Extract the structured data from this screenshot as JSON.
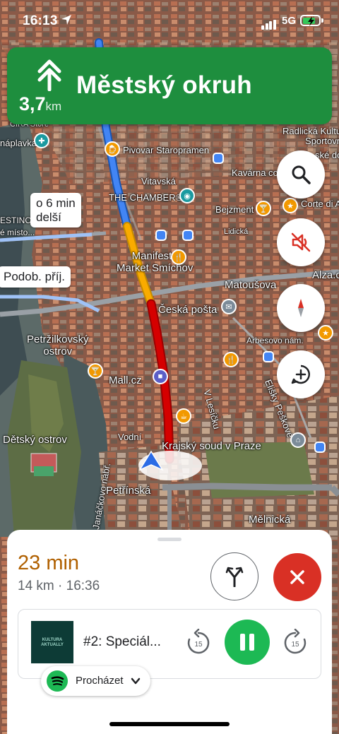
{
  "status_bar": {
    "time": "16:13",
    "network": "5G",
    "battery_level": 0.8,
    "battery_color": "#34c759"
  },
  "navigation": {
    "maneuver_icon": "merge-straight-icon",
    "distance_value": "3,7",
    "distance_unit": "km",
    "street": "Městský okruh",
    "banner_color": "#1e8e3e"
  },
  "map": {
    "callouts": [
      {
        "text": "o 6 min\ndelší"
      },
      {
        "text": "Podob. příj."
      }
    ],
    "labels": {
      "cira_store": "CIRA Store",
      "naplavka": "náplavka",
      "pivovar": "Pivovar Staropramen",
      "radlicka": "Radlická Kulturní",
      "sportovna": "Sportovna",
      "vitavska": "Vitavská",
      "kavarna": "Kavárna co h",
      "sko_dom": "ské dom",
      "the_chamber": "THE CHAMBER®",
      "bejzment": "Bejzment",
      "corte": "Corte di Al",
      "estino": "ESTINO",
      "e_misto": "é místo...",
      "lidicka": "Lidická",
      "manifesto": "Manifesto\nMarket Smíchov",
      "matousova": "Matoušova",
      "alza": "Alza.c",
      "ceska_posta": "Česká pošta",
      "petrzilkovsky": "Petržilkovský\nostrov",
      "arbesovo": "Arbesovo nám.",
      "mall": "Mall.cz",
      "v_lesicku": "V Lesíčku",
      "elisky": "Elišky Peškové",
      "detsky": "Dětský ostrov",
      "vodni": "Vodní",
      "krajsky": "Krajský soud v Praze",
      "janackovo": "Janáčkovo nábř.",
      "petrinska": "Petřínská",
      "melnicka": "Mělnická"
    },
    "route_colors": {
      "clear": "#4285f4",
      "slow": "#f9ab00",
      "jam": "#d50000"
    }
  },
  "controls": {
    "search_icon": "search-icon",
    "mute_icon": "mute-icon",
    "compass_icon": "compass-icon",
    "report_icon": "add-report-icon"
  },
  "trip": {
    "eta_duration": "23 min",
    "summary": "14 km · 16:36",
    "eta_color": "#b06000"
  },
  "media": {
    "album_art_text": "KULTURA\nAKTUALLY",
    "track_title": "#2: Speciál...",
    "rewind_seconds": "15",
    "forward_seconds": "15",
    "state": "playing",
    "browse_label": "Procházet",
    "spotify_color": "#1db954"
  }
}
